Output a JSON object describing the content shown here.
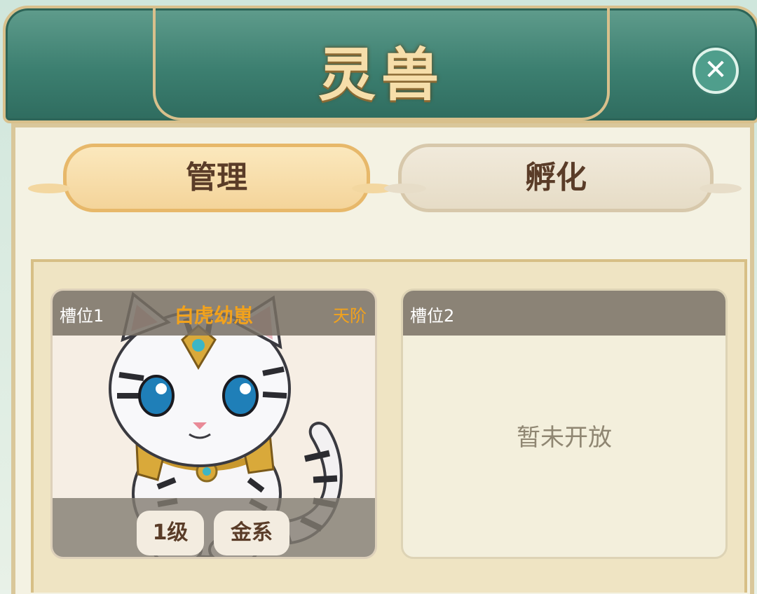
{
  "header": {
    "title": "灵兽"
  },
  "tabs": [
    {
      "label": "管理",
      "active": true
    },
    {
      "label": "孵化",
      "active": false
    }
  ],
  "slots": [
    {
      "slot_label": "槽位1",
      "pet_name": "白虎幼崽",
      "rank": "天阶",
      "level": "1级",
      "element": "金系"
    },
    {
      "slot_label": "槽位2",
      "status": "暂未开放"
    }
  ],
  "icons": {
    "close": "close-icon",
    "pet": "white-tiger-cub-icon"
  },
  "colors": {
    "title_gold": "#f6deaa",
    "banner_teal": "#3c7f70",
    "rank_orange": "#f2a21c"
  }
}
